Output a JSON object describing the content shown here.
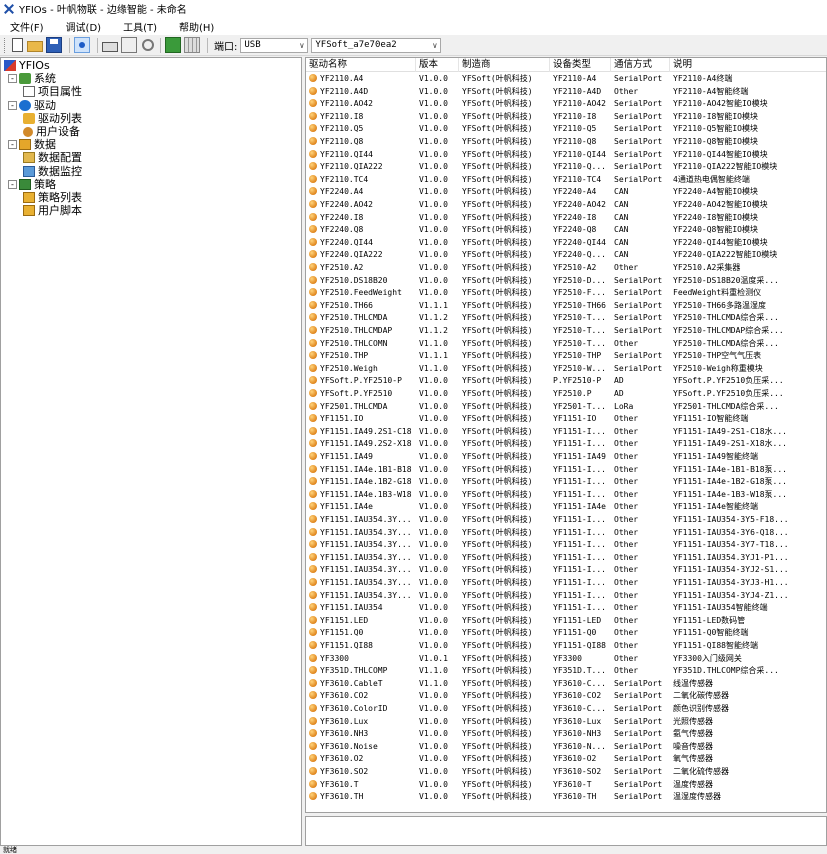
{
  "window": {
    "title": "YFIOs - 叶帆物联 - 边缘智能 - 未命名"
  },
  "menu": [
    "文件(F)",
    "调试(D)",
    "工具(T)",
    "帮助(H)"
  ],
  "toolbar": {
    "port_label": "端口:",
    "port_value": "USB",
    "device_value": "YFSoft_a7e70ea2"
  },
  "tree": [
    {
      "label": "YFIOs",
      "level": 0,
      "icon": "root",
      "expander": ""
    },
    {
      "label": "系统",
      "level": 1,
      "icon": "system",
      "expander": "-"
    },
    {
      "label": "项目属性",
      "level": 2,
      "icon": "props",
      "expander": ""
    },
    {
      "label": "驱动",
      "level": 1,
      "icon": "driver",
      "expander": "-"
    },
    {
      "label": "驱动列表",
      "level": 2,
      "icon": "list",
      "expander": ""
    },
    {
      "label": "用户设备",
      "level": 2,
      "icon": "gear",
      "expander": ""
    },
    {
      "label": "数据",
      "level": 1,
      "icon": "data",
      "expander": "-"
    },
    {
      "label": "数据配置",
      "level": 2,
      "icon": "config",
      "expander": ""
    },
    {
      "label": "数据监控",
      "level": 2,
      "icon": "monitor",
      "expander": ""
    },
    {
      "label": "策略",
      "level": 1,
      "icon": "strategy",
      "expander": "-"
    },
    {
      "label": "策略列表",
      "level": 2,
      "icon": "slist",
      "expander": ""
    },
    {
      "label": "用户脚本",
      "level": 2,
      "icon": "slist",
      "expander": ""
    }
  ],
  "table": {
    "columns": [
      "驱动名称",
      "版本",
      "制造商",
      "设备类型",
      "通信方式",
      "说明"
    ],
    "rows": [
      [
        "YF2110.A4",
        "V1.0.0",
        "YFSoft(叶帆科技)",
        "YF2110-A4",
        "SerialPort",
        "YF2110-A4终端"
      ],
      [
        "YF2110.A4D",
        "V1.0.0",
        "YFSoft(叶帆科技)",
        "YF2110-A4D",
        "Other",
        "YF2110-A4智能终端"
      ],
      [
        "YF2110.AO42",
        "V1.0.0",
        "YFSoft(叶帆科技)",
        "YF2110-AO42",
        "SerialPort",
        "YF2110-AO42智能IO模块"
      ],
      [
        "YF2110.I8",
        "V1.0.0",
        "YFSoft(叶帆科技)",
        "YF2110-I8",
        "SerialPort",
        "YF2110-I8智能IO模块"
      ],
      [
        "YF2110.Q5",
        "V1.0.0",
        "YFSoft(叶帆科技)",
        "YF2110-Q5",
        "SerialPort",
        "YF2110-Q5智能IO模块"
      ],
      [
        "YF2110.Q8",
        "V1.0.0",
        "YFSoft(叶帆科技)",
        "YF2110-Q8",
        "SerialPort",
        "YF2110-Q8智能IO模块"
      ],
      [
        "YF2110.QI44",
        "V1.0.0",
        "YFSoft(叶帆科技)",
        "YF2110-QI44",
        "SerialPort",
        "YF2110-QI44智能IO模块"
      ],
      [
        "YF2110.QIA222",
        "V1.0.0",
        "YFSoft(叶帆科技)",
        "YF2110-Q...",
        "SerialPort",
        "YF2110-QIA222智能IO模块"
      ],
      [
        "YF2110.TC4",
        "V1.0.0",
        "YFSoft(叶帆科技)",
        "YF2110-TC4",
        "SerialPort",
        "4通道热电偶智能终端"
      ],
      [
        "YF2240.A4",
        "V1.0.0",
        "YFSoft(叶帆科技)",
        "YF2240-A4",
        "CAN",
        "YF2240-A4智能IO模块"
      ],
      [
        "YF2240.AO42",
        "V1.0.0",
        "YFSoft(叶帆科技)",
        "YF2240-AO42",
        "CAN",
        "YF2240-AO42智能IO模块"
      ],
      [
        "YF2240.I8",
        "V1.0.0",
        "YFSoft(叶帆科技)",
        "YF2240-I8",
        "CAN",
        "YF2240-I8智能IO模块"
      ],
      [
        "YF2240.Q8",
        "V1.0.0",
        "YFSoft(叶帆科技)",
        "YF2240-Q8",
        "CAN",
        "YF2240-Q8智能IO模块"
      ],
      [
        "YF2240.QI44",
        "V1.0.0",
        "YFSoft(叶帆科技)",
        "YF2240-QI44",
        "CAN",
        "YF2240-QI44智能IO模块"
      ],
      [
        "YF2240.QIA222",
        "V1.0.0",
        "YFSoft(叶帆科技)",
        "YF2240-Q...",
        "CAN",
        "YF2240-QIA222智能IO模块"
      ],
      [
        "YF2510.A2",
        "V1.0.0",
        "YFSoft(叶帆科技)",
        "YF2510-A2",
        "Other",
        "YF2510.A2采集器"
      ],
      [
        "YF2510.DS18B20",
        "V1.0.0",
        "YFSoft(叶帆科技)",
        "YF2510-D...",
        "SerialPort",
        "YF2510-DS18B20温度采..."
      ],
      [
        "YF2510.FeedWeight",
        "V1.0.0",
        "YFSoft(叶帆科技)",
        "YF2510-F...",
        "SerialPort",
        "FeedWeight料重检测仪"
      ],
      [
        "YF2510.TH66",
        "V1.1.1",
        "YFSoft(叶帆科技)",
        "YF2510-TH66",
        "SerialPort",
        "YF2510-TH66多路温湿度"
      ],
      [
        "YF2510.THLCMDA",
        "V1.1.2",
        "YFSoft(叶帆科技)",
        "YF2510-T...",
        "SerialPort",
        "YF2510-THLCMDA综合采..."
      ],
      [
        "YF2510.THLCMDAP",
        "V1.1.2",
        "YFSoft(叶帆科技)",
        "YF2510-T...",
        "SerialPort",
        "YF2510-THLCMDAP综合采..."
      ],
      [
        "YF2510.THLCOMN",
        "V1.1.0",
        "YFSoft(叶帆科技)",
        "YF2510-T...",
        "Other",
        "YF2510-THLCMDA综合采..."
      ],
      [
        "YF2510.THP",
        "V1.1.1",
        "YFSoft(叶帆科技)",
        "YF2510-THP",
        "SerialPort",
        "YF2510-THP空气气压表"
      ],
      [
        "YF2510.Weigh",
        "V1.1.0",
        "YFSoft(叶帆科技)",
        "YF2510-W...",
        "SerialPort",
        "YF2510-Weigh称重模块"
      ],
      [
        "YFSoft.P.YF2510-P",
        "V1.0.0",
        "YFSoft(叶帆科技)",
        "P.YF2510-P",
        "AD",
        "YFSoft.P.YF2510负压采..."
      ],
      [
        "YFSoft.P.YF2510",
        "V1.0.0",
        "YFSoft(叶帆科技)",
        "YF2510.P",
        "AD",
        "YFSoft.P.YF2510负压采..."
      ],
      [
        "YF2501.THLCMDA",
        "V1.0.0",
        "YFSoft(叶帆科技)",
        "YF2501-T...",
        "LoRa",
        "YF2501-THLCMDA综合采..."
      ],
      [
        "YF1151.IO",
        "V1.0.0",
        "YFSoft(叶帆科技)",
        "YF1151-IO",
        "Other",
        "YF1151-IO智能终端"
      ],
      [
        "YF1151.IA49.2S1-C18",
        "V1.0.0",
        "YFSoft(叶帆科技)",
        "YF1151-I...",
        "Other",
        "YF1151-IA49-2S1-C18水..."
      ],
      [
        "YF1151.IA49.2S2-X18",
        "V1.0.0",
        "YFSoft(叶帆科技)",
        "YF1151-I...",
        "Other",
        "YF1151-IA49-2S1-X18水..."
      ],
      [
        "YF1151.IA49",
        "V1.0.0",
        "YFSoft(叶帆科技)",
        "YF1151-IA49",
        "Other",
        "YF1151-IA49智能终端"
      ],
      [
        "YF1151.IA4e.1B1-B18",
        "V1.0.0",
        "YFSoft(叶帆科技)",
        "YF1151-I...",
        "Other",
        "YF1151-IA4e-1B1-B18泵..."
      ],
      [
        "YF1151.IA4e.1B2-G18",
        "V1.0.0",
        "YFSoft(叶帆科技)",
        "YF1151-I...",
        "Other",
        "YF1151-IA4e-1B2-G18泵..."
      ],
      [
        "YF1151.IA4e.1B3-W18",
        "V1.0.0",
        "YFSoft(叶帆科技)",
        "YF1151-I...",
        "Other",
        "YF1151-IA4e-1B3-W18泵..."
      ],
      [
        "YF1151.IA4e",
        "V1.0.0",
        "YFSoft(叶帆科技)",
        "YF1151-IA4e",
        "Other",
        "YF1151-IA4e智能终端"
      ],
      [
        "YF1151.IAU354.3Y...",
        "V1.0.0",
        "YFSoft(叶帆科技)",
        "YF1151-I...",
        "Other",
        "YF1151-IAU354-3Y5-F18..."
      ],
      [
        "YF1151.IAU354.3Y...",
        "V1.0.0",
        "YFSoft(叶帆科技)",
        "YF1151-I...",
        "Other",
        "YF1151-IAU354-3Y6-Q18..."
      ],
      [
        "YF1151.IAU354.3Y...",
        "V1.0.0",
        "YFSoft(叶帆科技)",
        "YF1151-I...",
        "Other",
        "YF1151-IAU354-3Y7-T18..."
      ],
      [
        "YF1151.IAU354.3Y...",
        "V1.0.0",
        "YFSoft(叶帆科技)",
        "YF1151-I...",
        "Other",
        "YF1151.IAU354.3YJ1-P1..."
      ],
      [
        "YF1151.IAU354.3Y...",
        "V1.0.0",
        "YFSoft(叶帆科技)",
        "YF1151-I...",
        "Other",
        "YF1151-IAU354-3YJ2-S1..."
      ],
      [
        "YF1151.IAU354.3Y...",
        "V1.0.0",
        "YFSoft(叶帆科技)",
        "YF1151-I...",
        "Other",
        "YF1151-IAU354-3YJ3-H1..."
      ],
      [
        "YF1151.IAU354.3Y...",
        "V1.0.0",
        "YFSoft(叶帆科技)",
        "YF1151-I...",
        "Other",
        "YF1151-IAU354-3YJ4-Z1..."
      ],
      [
        "YF1151.IAU354",
        "V1.0.0",
        "YFSoft(叶帆科技)",
        "YF1151-I...",
        "Other",
        "YF1151-IAU354智能终端"
      ],
      [
        "YF1151.LED",
        "V1.0.0",
        "YFSoft(叶帆科技)",
        "YF1151-LED",
        "Other",
        "YF1151-LED数码管"
      ],
      [
        "YF1151.Q0",
        "V1.0.0",
        "YFSoft(叶帆科技)",
        "YF1151-Q0",
        "Other",
        "YF1151-Q0智能终端"
      ],
      [
        "YF1151.QI88",
        "V1.0.0",
        "YFSoft(叶帆科技)",
        "YF1151-QI88",
        "Other",
        "YF1151-QI88智能终端"
      ],
      [
        "YF3300",
        "V1.0.1",
        "YFSoft(叶帆科技)",
        "YF3300",
        "Other",
        "YF3300入门级网关"
      ],
      [
        "YF351D.THLCOMP",
        "V1.1.0",
        "YFSoft(叶帆科技)",
        "YF351D.T...",
        "Other",
        "YF351D.THLCOMP综合采..."
      ],
      [
        "YF3610.CableT",
        "V1.1.0",
        "YFSoft(叶帆科技)",
        "YF3610-C...",
        "SerialPort",
        "线温传感器"
      ],
      [
        "YF3610.CO2",
        "V1.0.0",
        "YFSoft(叶帆科技)",
        "YF3610-CO2",
        "SerialPort",
        "二氧化碳传感器"
      ],
      [
        "YF3610.ColorID",
        "V1.0.0",
        "YFSoft(叶帆科技)",
        "YF3610-C...",
        "SerialPort",
        "颜色识别传感器"
      ],
      [
        "YF3610.Lux",
        "V1.0.0",
        "YFSoft(叶帆科技)",
        "YF3610-Lux",
        "SerialPort",
        "光照传感器"
      ],
      [
        "YF3610.NH3",
        "V1.0.0",
        "YFSoft(叶帆科技)",
        "YF3610-NH3",
        "SerialPort",
        "氨气传感器"
      ],
      [
        "YF3610.Noise",
        "V1.0.0",
        "YFSoft(叶帆科技)",
        "YF3610-N...",
        "SerialPort",
        "噪音传感器"
      ],
      [
        "YF3610.O2",
        "V1.0.0",
        "YFSoft(叶帆科技)",
        "YF3610-O2",
        "SerialPort",
        "氧气传感器"
      ],
      [
        "YF3610.SO2",
        "V1.0.0",
        "YFSoft(叶帆科技)",
        "YF3610-SO2",
        "SerialPort",
        "二氧化硫传感器"
      ],
      [
        "YF3610.T",
        "V1.0.0",
        "YFSoft(叶帆科技)",
        "YF3610-T",
        "SerialPort",
        "温度传感器"
      ],
      [
        "YF3610.TH",
        "V1.0.0",
        "YFSoft(叶帆科技)",
        "YF3610-TH",
        "SerialPort",
        "温湿度传感器"
      ]
    ]
  },
  "status": {
    "text": "就绪"
  }
}
